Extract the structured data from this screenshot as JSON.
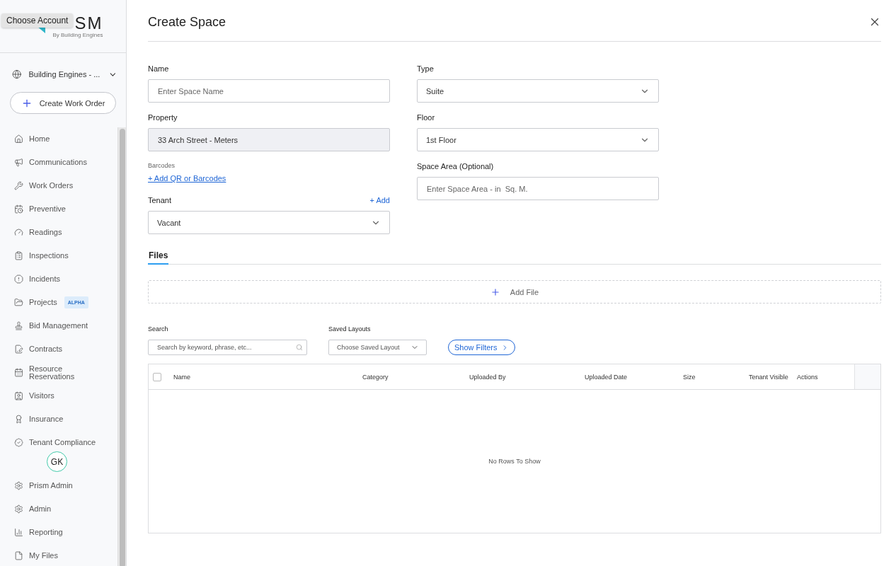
{
  "tooltip": {
    "text": "Choose Account"
  },
  "logo": {
    "text": "SM",
    "tagline": "By Building Engines"
  },
  "account": {
    "label": "Building Engines - ..."
  },
  "create_button": {
    "label": "Create Work Order"
  },
  "nav": [
    {
      "label": "Home"
    },
    {
      "label": "Communications"
    },
    {
      "label": "Work Orders"
    },
    {
      "label": "Preventive"
    },
    {
      "label": "Readings"
    },
    {
      "label": "Inspections"
    },
    {
      "label": "Incidents"
    },
    {
      "label": "Projects",
      "badge": "ALPHA"
    },
    {
      "label": "Bid Management"
    },
    {
      "label": "Contracts"
    },
    {
      "label": "Resource Reservations"
    },
    {
      "label": "Visitors"
    },
    {
      "label": "Insurance"
    },
    {
      "label": "Tenant Compliance"
    }
  ],
  "avatar": {
    "initials": "GK"
  },
  "bottom_nav": [
    {
      "label": "Prism Admin"
    },
    {
      "label": "Admin"
    },
    {
      "label": "Reporting"
    },
    {
      "label": "My Files"
    }
  ],
  "dialog": {
    "title": "Create Space"
  },
  "form_left": [
    {
      "kind": "input",
      "label": "Name",
      "placeholder": "Enter Space Name"
    },
    {
      "kind": "readonly",
      "label": "Property",
      "value": "33 Arch Street - Meters"
    },
    {
      "kind": "link",
      "label": "Barcodes",
      "link": "+ Add QR or Barcodes"
    },
    {
      "kind": "select",
      "label": "Tenant",
      "action": "+ Add",
      "value": "Vacant"
    }
  ],
  "form_right": [
    {
      "kind": "select",
      "label": "Type",
      "value": "Suite"
    },
    {
      "kind": "select",
      "label": "Floor",
      "value": "1st Floor"
    },
    {
      "kind": "input",
      "label": "Space Area (Optional)",
      "placeholder": "Enter Space Area - in  Sq. M."
    }
  ],
  "tabs": [
    {
      "label": "Files",
      "selected": true
    }
  ],
  "add_file": {
    "label": "Add File"
  },
  "search": {
    "label": "Search",
    "placeholder": "Search by keyword, phrase, etc..."
  },
  "saved_layouts": {
    "label": "Saved Layouts",
    "value": "Choose Saved Layout"
  },
  "show_filters": {
    "label": "Show Filters"
  },
  "table": {
    "select_all": {
      "checked": false
    },
    "columns": [
      "Name",
      "Category",
      "Uploaded By",
      "Uploaded Date",
      "Size",
      "Tenant Visible",
      "Actions"
    ],
    "empty": "No Rows To Show"
  }
}
